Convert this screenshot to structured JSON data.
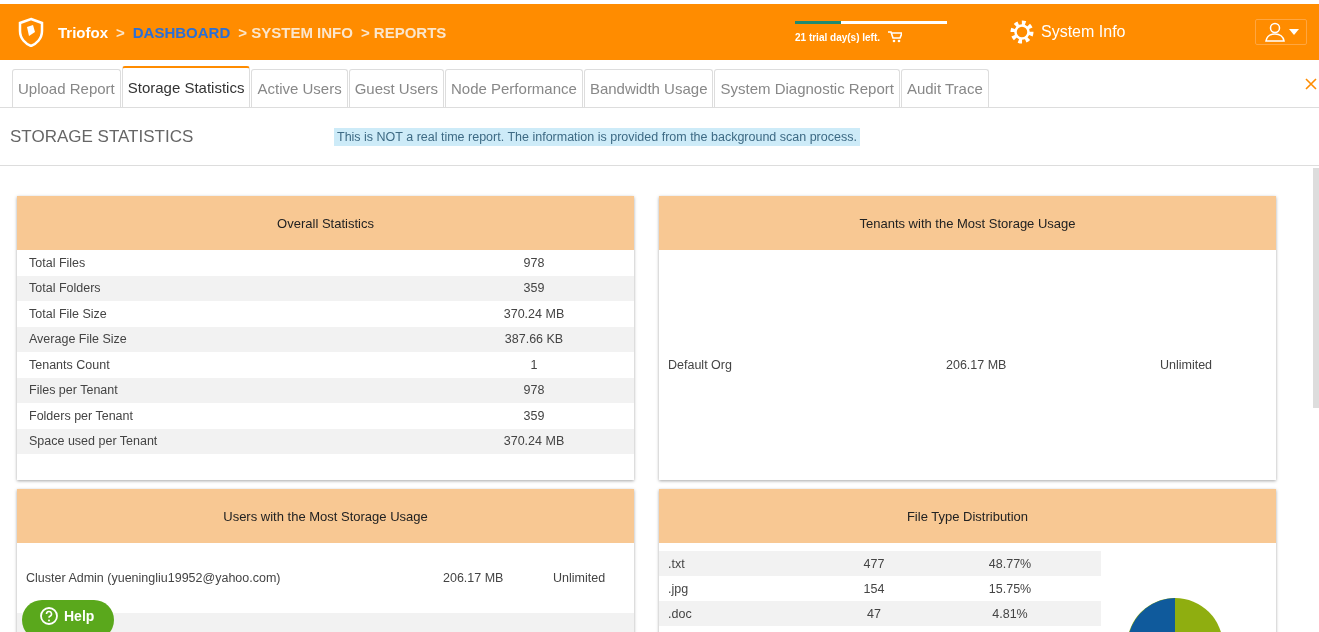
{
  "header": {
    "brand": "Triofox",
    "breadcrumb": [
      {
        "label": ">",
        "kind": "sep"
      },
      {
        "label": "DASHBOARD",
        "kind": "link"
      },
      {
        "label": "> SYSTEM INFO",
        "kind": "plain"
      },
      {
        "label": "> REPORTS",
        "kind": "plain"
      }
    ],
    "trial": {
      "level": 0.3,
      "text": "21 trial day(s) left."
    },
    "section": "System Info"
  },
  "tabs": [
    {
      "label": "Upload Report",
      "selected": false
    },
    {
      "label": "Storage Statistics",
      "selected": true
    },
    {
      "label": "Active Users",
      "selected": false
    },
    {
      "label": "Guest Users",
      "selected": false
    },
    {
      "label": "Node Performance",
      "selected": false
    },
    {
      "label": "Bandwidth Usage",
      "selected": false
    },
    {
      "label": "System Diagnostic Report",
      "selected": false
    },
    {
      "label": "Audit Trace",
      "selected": false
    }
  ],
  "page_title": "STORAGE STATISTICS",
  "notice": "This is NOT a real time report. The information is provided from the background scan process.",
  "overall": {
    "title": "Overall Statistics",
    "rows": [
      {
        "label": "Total Files",
        "value": "978"
      },
      {
        "label": "Total Folders",
        "value": "359"
      },
      {
        "label": "Total File Size",
        "value": "370.24 MB"
      },
      {
        "label": "Average File Size",
        "value": "387.66 KB"
      },
      {
        "label": "Tenants Count",
        "value": "1"
      },
      {
        "label": "Files per Tenant",
        "value": "978"
      },
      {
        "label": "Folders per Tenant",
        "value": "359"
      },
      {
        "label": "Space used per Tenant",
        "value": "370.24 MB"
      }
    ]
  },
  "tenants": {
    "title": "Tenants with the Most Storage Usage",
    "rows": [
      {
        "name": "Default Org",
        "used": "206.17 MB",
        "quota": "Unlimited"
      }
    ]
  },
  "users": {
    "title": "Users with the Most Storage Usage",
    "rows": [
      {
        "name": "Cluster Admin (yueningliu19952@yahoo.com)",
        "used": "206.17 MB",
        "quota": "Unlimited"
      }
    ]
  },
  "file_types": {
    "title": "File Type Distribution",
    "rows": [
      {
        "ext": ".txt",
        "count": "477",
        "share": "48.77%"
      },
      {
        "ext": ".jpg",
        "count": "154",
        "share": "15.75%"
      },
      {
        "ext": ".doc",
        "count": "47",
        "share": "4.81%"
      }
    ]
  },
  "help": "Help"
}
